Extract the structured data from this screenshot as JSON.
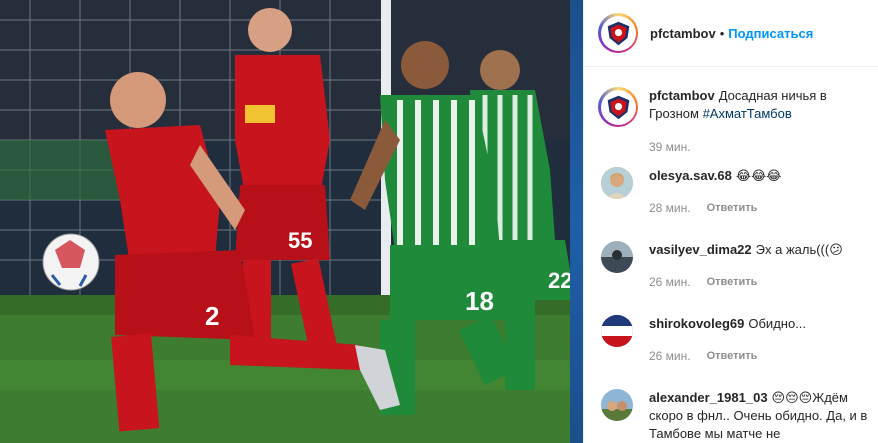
{
  "header": {
    "username": "pfctambov",
    "dot": "•",
    "follow_label": "Подписаться"
  },
  "caption": {
    "username": "pfctambov",
    "text": "Досадная ничья в Грозном",
    "hashtag": "#АхматТамбов",
    "time": "39 мин."
  },
  "comments": [
    {
      "username": "olesya.sav.68",
      "text": "😂😂😂",
      "time": "28 мин.",
      "reply": "Ответить"
    },
    {
      "username": "vasilyev_dima22",
      "text": "Эх а жаль(((😕",
      "time": "26 мин.",
      "reply": "Ответить"
    },
    {
      "username": "shirokovoleg69",
      "text": "Обидно...",
      "time": "26 мин.",
      "reply": "Ответить"
    },
    {
      "username": "alexander_1981_03",
      "text": "😔😔😔Ждём скоро в фнл.. Очень обидно. Да, и в Тамбове мы матче не",
      "time": "",
      "reply": ""
    }
  ],
  "photo": {
    "players": [
      {
        "team": "red",
        "number": "2"
      },
      {
        "team": "red",
        "number": "55"
      },
      {
        "team": "green",
        "number": "18"
      },
      {
        "team": "green",
        "number": "22"
      }
    ]
  },
  "colors": {
    "link_blue": "#0095f6",
    "hashtag_blue": "#00376b",
    "muted_text": "#8e8e8e",
    "red_kit": "#c8141c",
    "green_kit": "#1e8a3a"
  }
}
